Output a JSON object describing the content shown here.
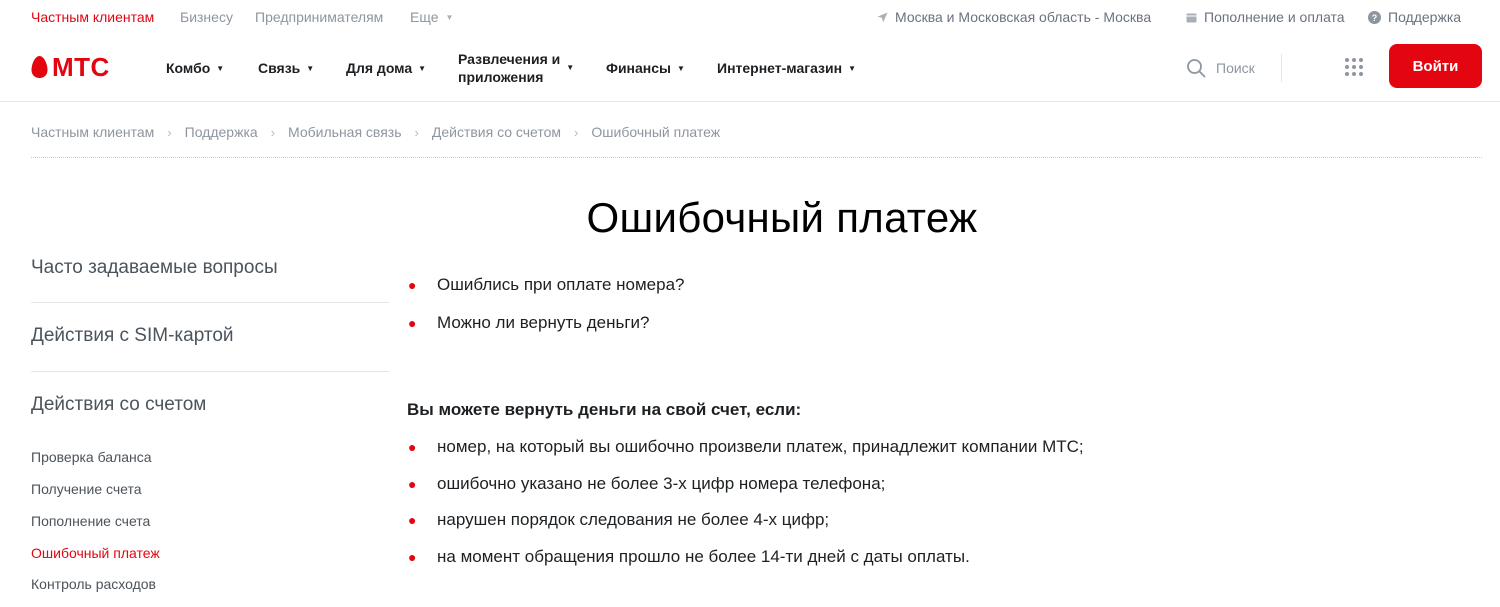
{
  "topbar": {
    "segments": [
      "Частным клиентам",
      "Бизнесу",
      "Предпринимателям",
      "Еще"
    ],
    "region": "Москва и Московская область - Москва",
    "payment": "Пополнение и оплата",
    "support": "Поддержка"
  },
  "header": {
    "logo": "МТС",
    "nav": [
      "Комбо",
      "Связь",
      "Для дома",
      "Развлечения и",
      "приложения",
      "Финансы",
      "Интернет-магазин"
    ],
    "search_label": "Поиск",
    "login_label": "Войти"
  },
  "breadcrumb": [
    "Частным клиентам",
    "Поддержка",
    "Мобильная связь",
    "Действия со счетом",
    "Ошибочный платеж"
  ],
  "page": {
    "title": "Ошибочный платеж"
  },
  "sidebar": {
    "sections": [
      "Часто задаваемые вопросы",
      "Действия с SIM-картой",
      "Действия со счетом"
    ],
    "links": [
      "Проверка баланса",
      "Получение счета",
      "Пополнение счета",
      "Ошибочный платеж",
      "Контроль расходов"
    ],
    "active_link": "Ошибочный платеж"
  },
  "content": {
    "questions": [
      "Ошиблись при оплате номера?",
      "Можно ли вернуть деньги?"
    ],
    "lead": "Вы можете вернуть деньги на свой счет, если:",
    "conditions": [
      "номер, на который вы ошибочно произвели платеж, принадлежит компании МТС;",
      "ошибочно указано не более 3-х цифр номера телефона;",
      "нарушен порядок следования не более 4-х цифр;",
      "на момент обращения прошло не более 14-ти дней с даты оплаты."
    ]
  },
  "colors": {
    "brand": "#e30611",
    "text": "#1d2023",
    "muted": "#8d969f"
  },
  "icons": [
    "location-arrow-icon",
    "wallet-icon",
    "help-circle-icon",
    "mts-egg-icon",
    "search-icon",
    "apps-grid-icon"
  ]
}
